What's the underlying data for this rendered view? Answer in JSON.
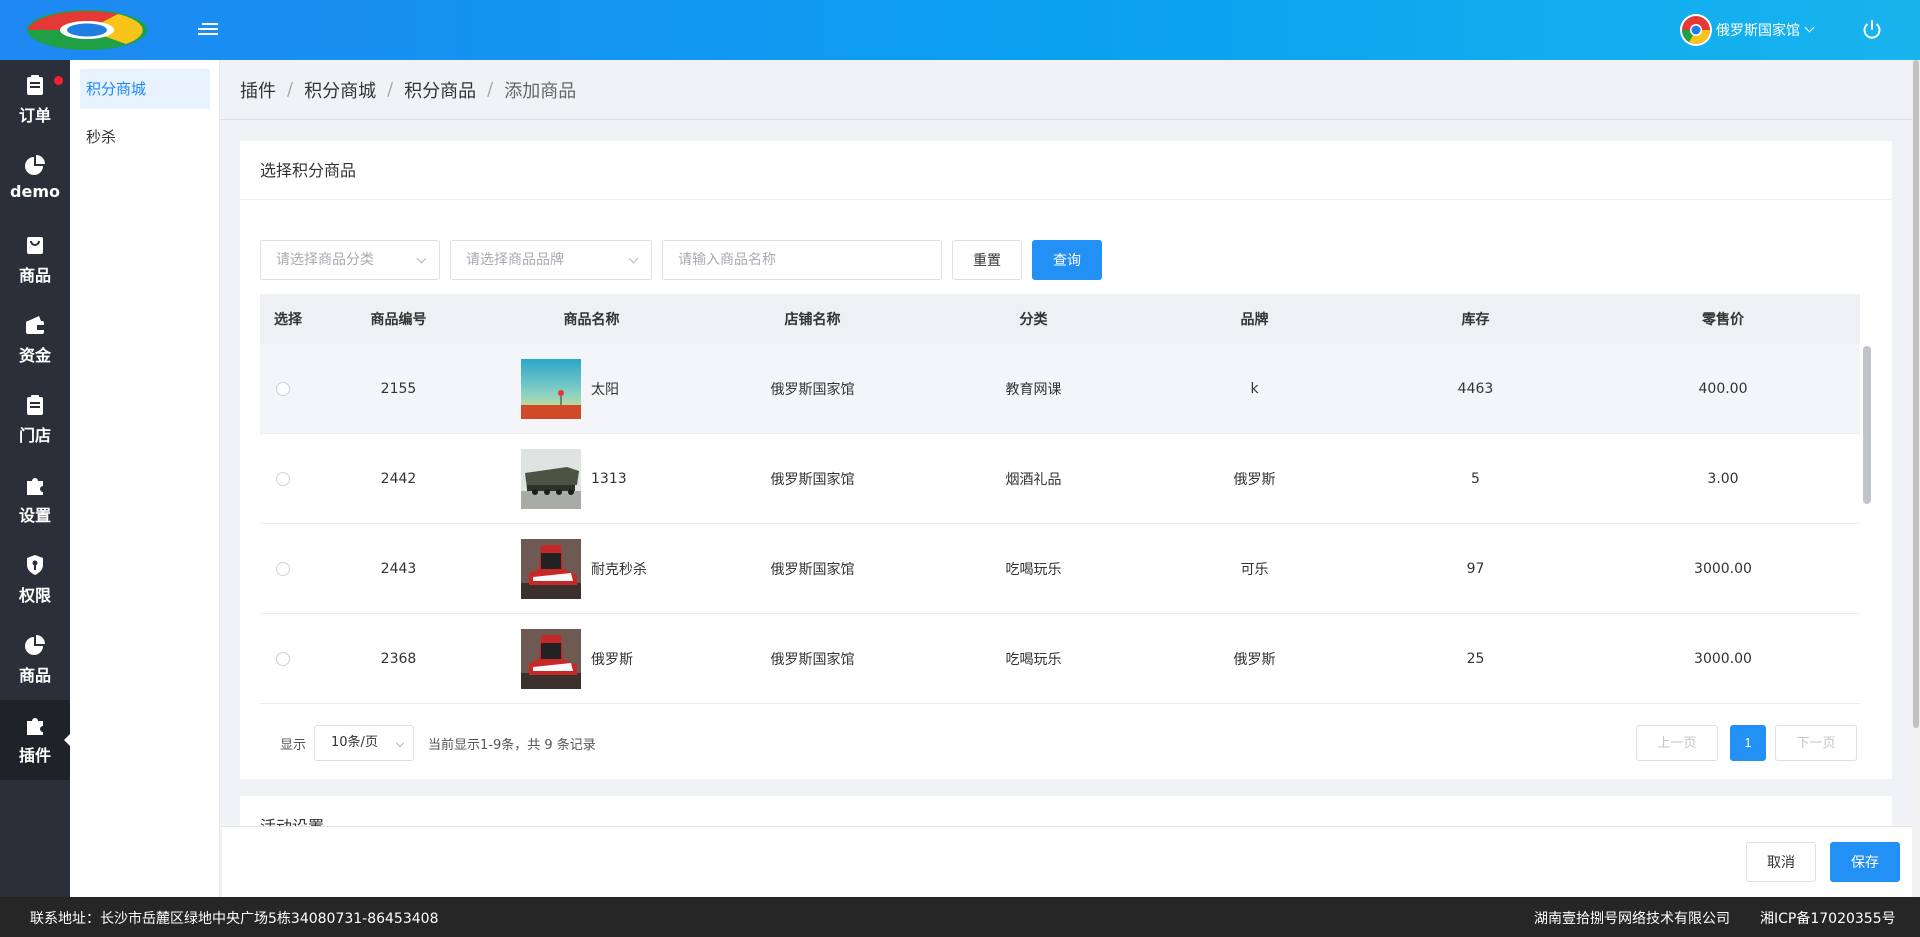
{
  "header": {
    "user_name": "俄罗斯国家馆"
  },
  "main_nav": [
    {
      "label": "订单",
      "icon": "clipboard-icon"
    },
    {
      "label": "demo",
      "icon": "pie-chart-icon"
    },
    {
      "label": "商品",
      "icon": "shopping-bag-icon"
    },
    {
      "label": "资金",
      "icon": "wallet-icon"
    },
    {
      "label": "门店",
      "icon": "clipboard-icon"
    },
    {
      "label": "设置",
      "icon": "puzzle-icon"
    },
    {
      "label": "权限",
      "icon": "shield-icon"
    },
    {
      "label": "商品",
      "icon": "pie-chart-icon"
    },
    {
      "label": "插件",
      "icon": "puzzle-icon",
      "active": true
    }
  ],
  "sub_nav": [
    {
      "label": "积分商城",
      "active": true
    },
    {
      "label": "秒杀"
    }
  ],
  "breadcrumb": [
    "插件",
    "积分商城",
    "积分商品",
    "添加商品"
  ],
  "card": {
    "title": "选择积分商品",
    "category_placeholder": "请选择商品分类",
    "brand_placeholder": "请选择商品品牌",
    "name_placeholder": "请输入商品名称",
    "reset_label": "重置",
    "search_label": "查询"
  },
  "table": {
    "columns": [
      "选择",
      "商品编号",
      "商品名称",
      "店铺名称",
      "分类",
      "品牌",
      "库存",
      "零售价"
    ],
    "rows": [
      {
        "id": "2155",
        "name": "太阳",
        "shop": "俄罗斯国家馆",
        "category": "教育网课",
        "brand": "k",
        "stock": "4463",
        "price": "400.00",
        "thumb": "sun-painting"
      },
      {
        "id": "2442",
        "name": "1313",
        "shop": "俄罗斯国家馆",
        "category": "烟酒礼品",
        "brand": "俄罗斯",
        "stock": "5",
        "price": "3.00",
        "thumb": "missile-truck"
      },
      {
        "id": "2443",
        "name": "耐克秒杀",
        "shop": "俄罗斯国家馆",
        "category": "吃喝玩乐",
        "brand": "可乐",
        "stock": "97",
        "price": "3000.00",
        "thumb": "sneaker"
      },
      {
        "id": "2368",
        "name": "俄罗斯",
        "shop": "俄罗斯国家馆",
        "category": "吃喝玩乐",
        "brand": "俄罗斯",
        "stock": "25",
        "price": "3000.00",
        "thumb": "sneaker"
      }
    ]
  },
  "pagination": {
    "show_label": "显示",
    "page_size": "10条/页",
    "summary": "当前显示1-9条，共 9 条记录",
    "prev_label": "上一页",
    "current_page": "1",
    "next_label": "下一页"
  },
  "section2_title": "活动设置",
  "actions": {
    "cancel_label": "取消",
    "save_label": "保存"
  },
  "footer": {
    "address": "联系地址：长沙市岳麓区绿地中央广场5栋34080731-86453408",
    "company": "湖南壹拾捌号网络技术有限公司",
    "icp": "湘ICP备17020355号"
  },
  "colors": {
    "primary": "#2390f5",
    "header_gradient_start": "#1e88f2",
    "sidebar_bg": "#2b2f3a",
    "badge_red": "#f5222d"
  }
}
